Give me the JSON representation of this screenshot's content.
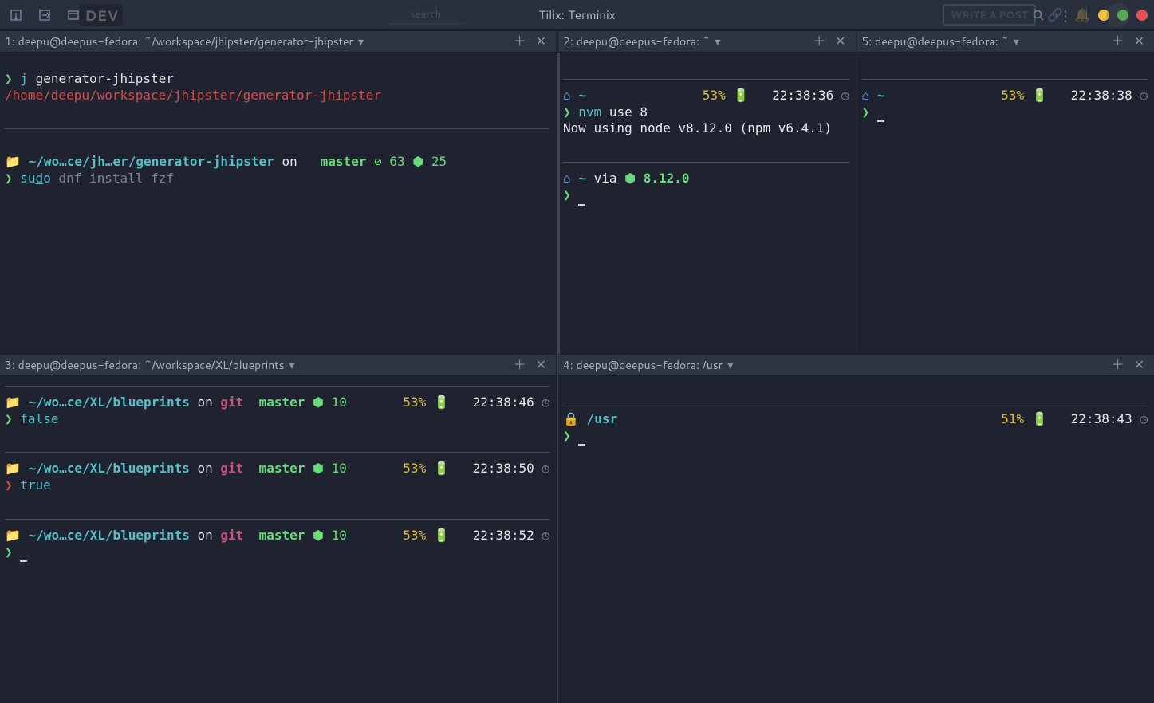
{
  "window": {
    "title": "Tilix: Terminix"
  },
  "ghost": {
    "brand": "DEV",
    "search": "search",
    "write": "WRITE A POST"
  },
  "panes": {
    "p1": {
      "tab_label": "1: deepu@deepus-fedora: ~/workspace/jhipster/generator-jhipster",
      "cmd1_prefix": "j",
      "cmd1_arg": "generator-jhipster",
      "path": "/home/deepu/workspace/jhipster/generator-jhipster",
      "ps_dir": "~/wo…ce/jh…er/generator-jhipster",
      "ps_word_on": "on",
      "git_icon": "",
      "branch_icon": "",
      "branch": "master",
      "pending_icon": "⊘",
      "pending": "63",
      "stash_icon": "⬢",
      "stash": "25",
      "cmd2_sudo": "su",
      "cmd2_sudo_u": "d",
      "cmd2_sudo_o": "o",
      "cmd2_cmd": "dnf install fzf"
    },
    "p2": {
      "tab_label": "2: deepu@deepus-fedora: ~",
      "left": {
        "tilde": "~",
        "batt": "53%",
        "time": "22:38:36",
        "cmd": "nvm",
        "cmd_args": "use 8",
        "out": "Now using node v8.12.0 (npm v6.4.1)",
        "p2_tilde": "~",
        "p2_via": "via",
        "p2_node_icon": "⬢",
        "p2_node": "8.12.0"
      }
    },
    "p5": {
      "tab_label": "5: deepu@deepus-fedora: ~",
      "tilde": "~",
      "batt": "53%",
      "time": "22:38:38"
    },
    "p3": {
      "tab_label": "3: deepu@deepus-fedora: ~/workspace/XL/blueprints",
      "rows": [
        {
          "dir": "~/wo…ce/XL/blueprints",
          "on": "on",
          "git": "git",
          "branch": "master",
          "stash_icon": "⬢",
          "stash": "10",
          "batt": "53%",
          "time": "22:38:46",
          "cmd": "false",
          "arrow": "green"
        },
        {
          "dir": "~/wo…ce/XL/blueprints",
          "on": "on",
          "git": "git",
          "branch": "master",
          "stash_icon": "⬢",
          "stash": "10",
          "batt": "53%",
          "time": "22:38:50",
          "cmd": "true",
          "arrow": "red"
        },
        {
          "dir": "~/wo…ce/XL/blueprints",
          "on": "on",
          "git": "git",
          "branch": "master",
          "stash_icon": "⬢",
          "stash": "10",
          "batt": "53%",
          "time": "22:38:52",
          "cmd": "",
          "arrow": "green"
        }
      ]
    },
    "p4": {
      "tab_label": "4: deepu@deepus-fedora: /usr",
      "lock": "🔒",
      "dir": "/usr",
      "batt": "51%",
      "time": "22:38:43"
    }
  }
}
